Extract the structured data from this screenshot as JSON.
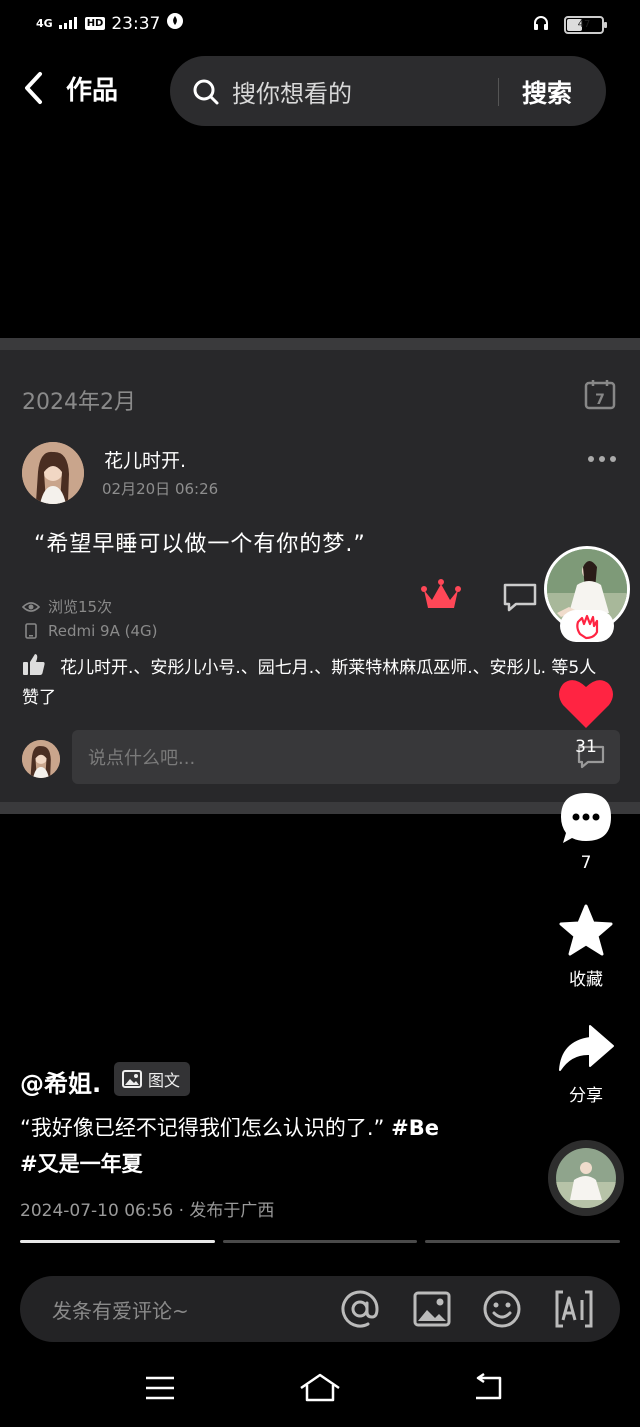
{
  "status_bar": {
    "network": "4G",
    "hd": "HD",
    "time": "23:37",
    "battery": "47",
    "battery_level": 0.47
  },
  "nav": {
    "title": "作品",
    "search_placeholder": "搜你想看的",
    "search_button": "搜索"
  },
  "post": {
    "date_title": "2024年2月",
    "author": "花儿时开.",
    "time": "02月20日 06:26",
    "quote": "“希望早睡可以做一个有你的梦.”",
    "views": "浏览15次",
    "device": "Redmi 9A (4G)",
    "likes_text": "花儿时开.、安彤儿小号.、园七月.、斯莱特林麻瓜巫师.、安彤儿. 等5人赞了",
    "comment_placeholder": "说点什么吧..."
  },
  "rail": {
    "like_count": "31",
    "comment_count": "7",
    "favorite_label": "收藏",
    "share_label": "分享"
  },
  "caption": {
    "author": "@希姐.",
    "badge": "图文",
    "text": "“我好像已经不记得我们怎么认识的了.”",
    "tag1": "#Be",
    "tag2": "#又是一年夏",
    "meta": "2024-07-10 06:56 · 发布于广西"
  },
  "progress": [
    1.0,
    0.0,
    0.0
  ],
  "bottom_bar": {
    "placeholder": "发条有爱评论~"
  },
  "colors": {
    "like_red": "#ff2442",
    "crown_red": "#ff4757",
    "card_bg": "#28282a"
  }
}
